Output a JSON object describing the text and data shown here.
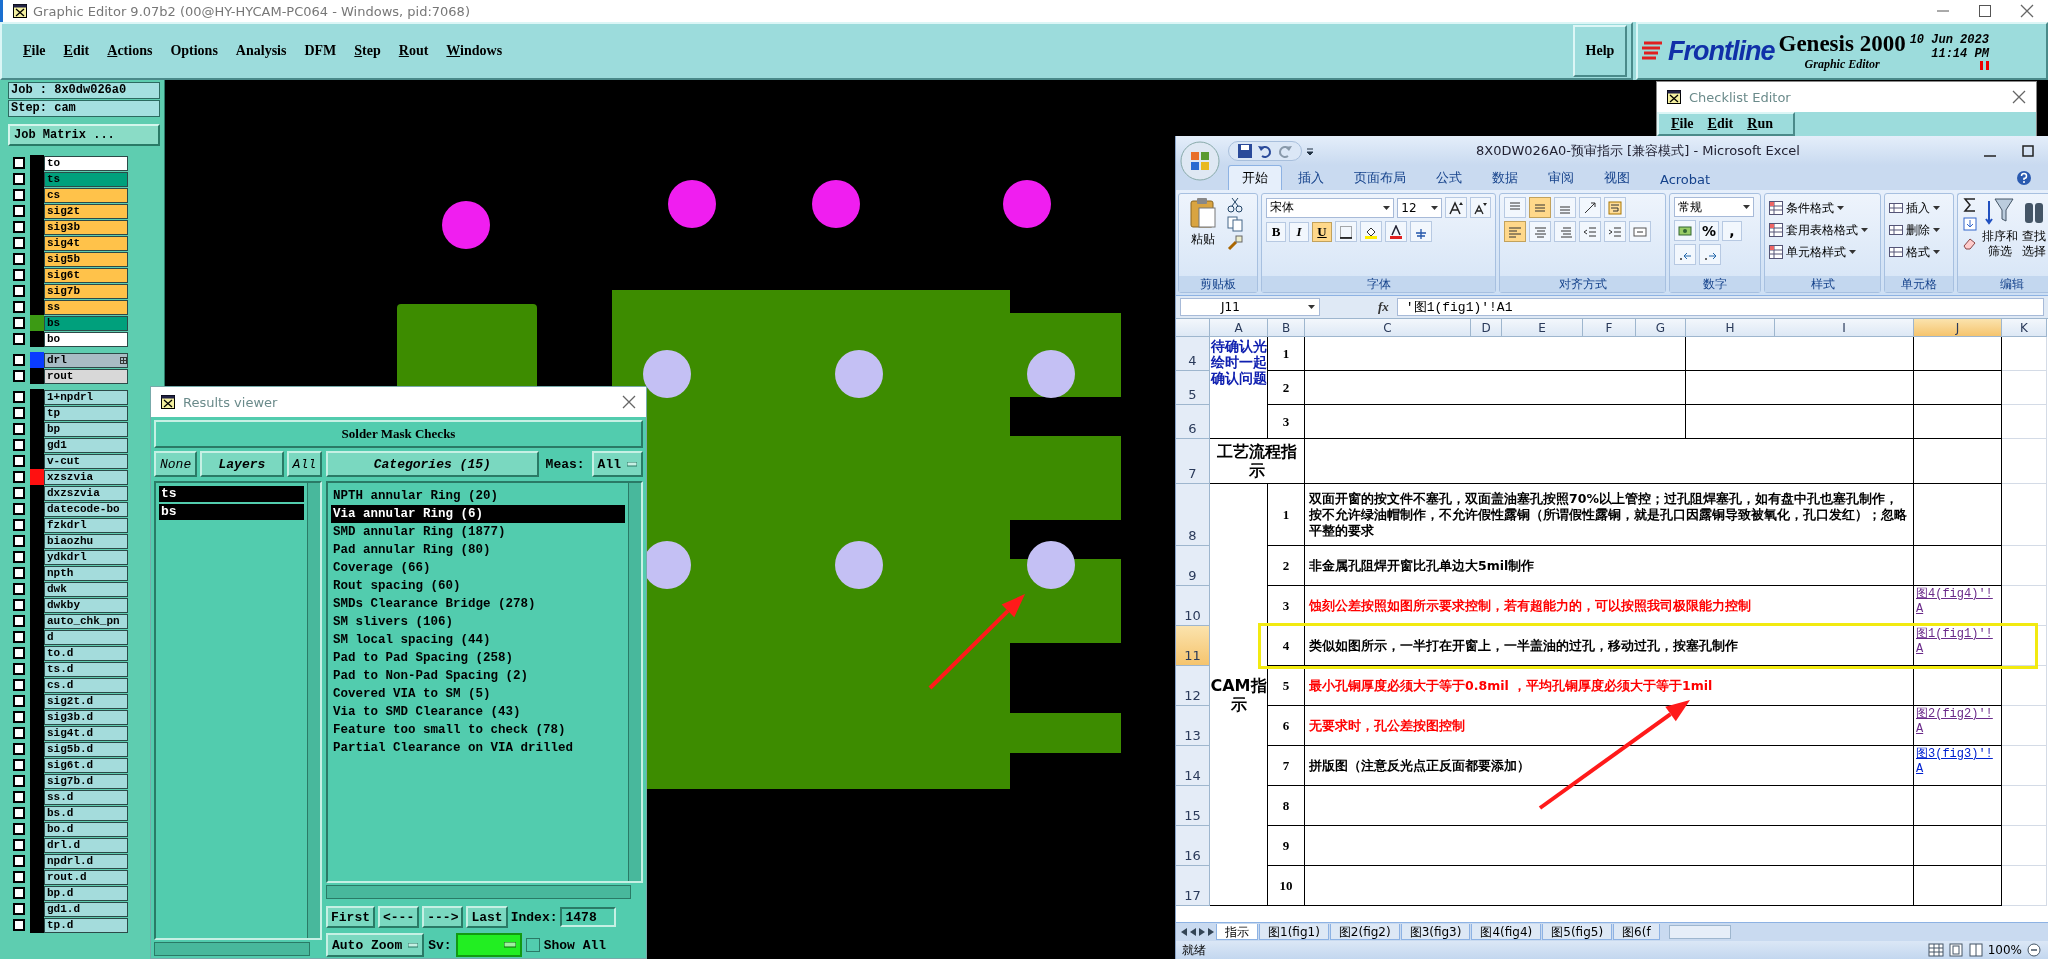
{
  "genesis": {
    "title": "Graphic Editor 9.07b2 (00@HY-HYCAM-PC064 - Windows, pid:7068)",
    "menu": [
      {
        "label": "File",
        "mnemonic": true
      },
      {
        "label": "Edit",
        "mnemonic": true
      },
      {
        "label": "Actions",
        "mnemonic": true
      },
      {
        "label": "Options",
        "mnemonic": false
      },
      {
        "label": "Analysis",
        "mnemonic": false
      },
      {
        "label": "DFM",
        "mnemonic": false
      },
      {
        "label": "Step",
        "mnemonic": true
      },
      {
        "label": "Rout",
        "mnemonic": true
      },
      {
        "label": "Windows",
        "mnemonic": true
      }
    ],
    "help": "Help",
    "logo": {
      "brand": "Frontline",
      "product": "Genesis 2000",
      "subtitle": "Graphic Editor",
      "date": "10 Jun 2023",
      "time": "11:14 PM"
    },
    "job": "Job : 8x0dw026a0",
    "step": "Step: cam",
    "job_matrix": "Job Matrix ...",
    "layer_groups": [
      [
        {
          "name": "to",
          "color": "#ffffff",
          "checked": false
        },
        {
          "name": "ts",
          "color": "#00a07c",
          "checked": false
        },
        {
          "name": "cs",
          "color": "#ffc24a",
          "checked": false
        },
        {
          "name": "sig2t",
          "color": "#ffc24a",
          "checked": false
        },
        {
          "name": "sig3b",
          "color": "#ffc24a",
          "checked": false
        },
        {
          "name": "sig4t",
          "color": "#ffc24a",
          "checked": false
        },
        {
          "name": "sig5b",
          "color": "#ffc24a",
          "checked": false
        },
        {
          "name": "sig6t",
          "color": "#ffc24a",
          "checked": false
        },
        {
          "name": "sig7b",
          "color": "#ffc24a",
          "checked": false
        },
        {
          "name": "ss",
          "color": "#ffc24a",
          "checked": false
        },
        {
          "name": "bs",
          "color": "#00a07c",
          "checked": false,
          "swatch": {
            "color": "#3c9a14"
          }
        },
        {
          "name": "bo",
          "color": "#ffffff",
          "checked": false
        }
      ],
      [
        {
          "name": "drl",
          "color": "#a8bcc4",
          "checked": false,
          "swatch": {
            "color": "#0a3cff"
          },
          "flag": true
        },
        {
          "name": "rout",
          "color": "#d8d8d8",
          "checked": false
        }
      ],
      [
        {
          "name": "1+npdrl",
          "color": "#a4dcdc",
          "checked": false
        },
        {
          "name": "tp",
          "color": "#a4dcdc",
          "checked": false
        },
        {
          "name": "bp",
          "color": "#a4dcdc",
          "checked": false
        },
        {
          "name": "gd1",
          "color": "#a4dcdc",
          "checked": false
        },
        {
          "name": "v-cut",
          "color": "#a4dcdc",
          "checked": false
        },
        {
          "name": "xzszvia",
          "color": "#a4dcdc",
          "checked": false,
          "swatch": {
            "color": "#ff1010"
          }
        },
        {
          "name": "dxzszvia",
          "color": "#a4dcdc",
          "checked": false
        },
        {
          "name": "datecode-bo",
          "color": "#a4dcdc",
          "checked": false
        },
        {
          "name": "fzkdrl",
          "color": "#a4dcdc",
          "checked": false
        },
        {
          "name": "biaozhu",
          "color": "#a4dcdc",
          "checked": false
        },
        {
          "name": "ydkdrl",
          "color": "#a4dcdc",
          "checked": false
        },
        {
          "name": "npth",
          "color": "#a4dcdc",
          "checked": false
        },
        {
          "name": "dwk",
          "color": "#a4dcdc",
          "checked": false
        },
        {
          "name": "dwkby",
          "color": "#a4dcdc",
          "checked": false
        },
        {
          "name": "auto_chk_pn",
          "color": "#a4dcdc",
          "checked": false
        },
        {
          "name": "d",
          "color": "#a4dcdc",
          "checked": false
        },
        {
          "name": "to.d",
          "color": "#a4dcdc",
          "checked": false
        },
        {
          "name": "ts.d",
          "color": "#a4dcdc",
          "checked": false
        },
        {
          "name": "cs.d",
          "color": "#a4dcdc",
          "checked": false
        },
        {
          "name": "sig2t.d",
          "color": "#a4dcdc",
          "checked": false
        },
        {
          "name": "sig3b.d",
          "color": "#a4dcdc",
          "checked": false
        },
        {
          "name": "sig4t.d",
          "color": "#a4dcdc",
          "checked": false
        },
        {
          "name": "sig5b.d",
          "color": "#a4dcdc",
          "checked": false
        },
        {
          "name": "sig6t.d",
          "color": "#a4dcdc",
          "checked": false
        },
        {
          "name": "sig7b.d",
          "color": "#a4dcdc",
          "checked": false
        },
        {
          "name": "ss.d",
          "color": "#a4dcdc",
          "checked": false
        },
        {
          "name": "bs.d",
          "color": "#a4dcdc",
          "checked": false
        },
        {
          "name": "bo.d",
          "color": "#a4dcdc",
          "checked": false
        },
        {
          "name": "drl.d",
          "color": "#a4dcdc",
          "checked": false
        },
        {
          "name": "npdrl.d",
          "color": "#a4dcdc",
          "checked": false
        },
        {
          "name": "rout.d",
          "color": "#a4dcdc",
          "checked": false
        },
        {
          "name": "bp.d",
          "color": "#a4dcdc",
          "checked": false
        },
        {
          "name": "gd1.d",
          "color": "#a4dcdc",
          "checked": false
        },
        {
          "name": "tp.d",
          "color": "#a4dcdc",
          "checked": false
        }
      ]
    ]
  },
  "results_viewer": {
    "title": "Results viewer",
    "header": "Solder Mask Checks",
    "layer_buttons": [
      {
        "label": "None",
        "kind": "action"
      },
      {
        "label": "Layers",
        "kind": "title"
      },
      {
        "label": "All",
        "kind": "action"
      }
    ],
    "layers": [
      {
        "name": "ts",
        "selected": true
      },
      {
        "name": "bs",
        "selected": true
      }
    ],
    "categories_button": "Categories (15)",
    "meas_label": "Meas:",
    "meas_value": "All",
    "categories": [
      {
        "label": "NPTH annular Ring (20)",
        "selected": false
      },
      {
        "label": "Via annular Ring (6)",
        "selected": true
      },
      {
        "label": "SMD annular Ring (1877)",
        "selected": false
      },
      {
        "label": "Pad annular Ring (80)",
        "selected": false
      },
      {
        "label": "Coverage (66)",
        "selected": false
      },
      {
        "label": "Rout spacing (60)",
        "selected": false
      },
      {
        "label": "SMDs Clearance Bridge (278)",
        "selected": false
      },
      {
        "label": "SM slivers (106)",
        "selected": false
      },
      {
        "label": "SM local spacing (44)",
        "selected": false
      },
      {
        "label": "Pad to Pad Spacing (258)",
        "selected": false
      },
      {
        "label": "Pad to Non-Pad Spacing (2)",
        "selected": false
      },
      {
        "label": "Covered VIA to SM (5)",
        "selected": false
      },
      {
        "label": "Via to SMD Clearance (43)",
        "selected": false
      },
      {
        "label": "Feature too small to check (78)",
        "selected": false
      },
      {
        "label": "Partial Clearance on VIA drilled",
        "selected": false
      }
    ],
    "nav_buttons": [
      "First",
      "<---",
      "--->",
      "Last"
    ],
    "index_label": "Index:",
    "index_value": "1478",
    "zoom_mode": "Auto Zoom",
    "sv_label": "Sv:",
    "show_all": {
      "label": "Show All",
      "checked": false
    }
  },
  "checklist_editor": {
    "title": "Checklist Editor",
    "menu": [
      {
        "label": "File",
        "mnemonic": true
      },
      {
        "label": "Edit",
        "mnemonic": true
      },
      {
        "label": "Run",
        "mnemonic": true
      }
    ]
  },
  "excel": {
    "title": "8X0DW026A0-预审指示 [兼容模式] - Microsoft Excel",
    "tabs": [
      {
        "label": "开始",
        "selected": true
      },
      {
        "label": "插入",
        "selected": false
      },
      {
        "label": "页面布局",
        "selected": false
      },
      {
        "label": "公式",
        "selected": false
      },
      {
        "label": "数据",
        "selected": false
      },
      {
        "label": "审阅",
        "selected": false
      },
      {
        "label": "视图",
        "selected": false
      },
      {
        "label": "Acrobat",
        "selected": false
      }
    ],
    "ribbon": {
      "paste": "粘贴",
      "clipboard_group": "剪贴板",
      "font_name": "宋体",
      "font_size": "12",
      "format_buttons": [
        {
          "label": "B",
          "selected": false
        },
        {
          "label": "I",
          "selected": false
        },
        {
          "label": "U",
          "selected": true
        }
      ],
      "font_group": "字体",
      "valign": [
        {
          "selected": false
        },
        {
          "selected": true
        },
        {
          "selected": false
        }
      ],
      "halign": [
        {
          "selected": true
        },
        {
          "selected": false
        },
        {
          "selected": false
        }
      ],
      "align_group": "对齐方式",
      "number_format": "常规",
      "percent": "%",
      "comma": ",",
      "number_group": "数字",
      "styles": [
        "条件格式",
        "套用表格格式",
        "单元格样式"
      ],
      "styles_group": "样式",
      "cells": [
        "插入",
        "删除",
        "格式"
      ],
      "cells_group": "单元格",
      "sort": "排序和筛选",
      "find": "查找",
      "select": "选择",
      "edit_group": "编辑"
    },
    "name_box": "J11",
    "fx": "fx",
    "formula": "'图1(fig1)'!A1",
    "sheet": {
      "columns": [
        {
          "label": "A",
          "selected": false
        },
        {
          "label": "B",
          "selected": false
        },
        {
          "label": "C",
          "selected": false
        },
        {
          "label": "D",
          "selected": false
        },
        {
          "label": "E",
          "selected": false
        },
        {
          "label": "F",
          "selected": false
        },
        {
          "label": "G",
          "selected": false
        },
        {
          "label": "H",
          "selected": false
        },
        {
          "label": "I",
          "selected": false
        },
        {
          "label": "J",
          "selected": true
        },
        {
          "label": "K",
          "selected": false
        }
      ],
      "rows": [
        {
          "label": "4",
          "selected": false
        },
        {
          "label": "5",
          "selected": false
        },
        {
          "label": "6",
          "selected": false
        },
        {
          "label": "7",
          "selected": false
        },
        {
          "label": "8",
          "selected": false
        },
        {
          "label": "9",
          "selected": false
        },
        {
          "label": "10",
          "selected": false
        },
        {
          "label": "11",
          "selected": true
        },
        {
          "label": "12",
          "selected": false
        },
        {
          "label": "13",
          "selected": false
        },
        {
          "label": "14",
          "selected": false
        },
        {
          "label": "15",
          "selected": false
        },
        {
          "label": "16",
          "selected": false
        },
        {
          "label": "17",
          "selected": false
        }
      ],
      "pending": {
        "label": "待确认光绘时一起确认问题",
        "items": [
          "1",
          "2",
          "3"
        ]
      },
      "process": {
        "label": "工艺流程指示"
      },
      "cam": {
        "label": "CAM指示",
        "items": [
          {
            "no": "1",
            "text": "双面开窗的按文件不塞孔，双面盖油塞孔按照70%以上管控；过孔阻焊塞孔，如有盘中孔也塞孔制作，按不允许绿油帽制作，不允许假性露铜（所谓假性露铜，就是孔口因露铜导致被氧化，孔口发红）；忽略平整的要求",
            "kind": "normal",
            "highlighted": false
          },
          {
            "no": "2",
            "text": "非金属孔阻焊开窗比孔单边大5mil制作",
            "kind": "normal",
            "highlighted": false
          },
          {
            "no": "3",
            "text": "蚀刻公差按照如图所示要求控制，若有超能力的，可以按照我司极限能力控制",
            "kind": "warning",
            "highlighted": false,
            "link": "图4(fig4)'!A",
            "visited": true
          },
          {
            "no": "4",
            "text": "类似如图所示，一半打在开窗上，一半盖油的过孔，移动过孔，按塞孔制作",
            "kind": "normal",
            "highlighted": true,
            "link": "图1(fig1)'!A",
            "visited": true
          },
          {
            "no": "5",
            "text": "最小孔铜厚度必须大于等于0.8mil ，平均孔铜厚度必须大于等于1mil",
            "kind": "warning",
            "highlighted": false
          },
          {
            "no": "6",
            "text": "无要求时，孔公差按图控制",
            "kind": "warning",
            "highlighted": false,
            "link": "图2(fig2)'!A",
            "visited": true
          },
          {
            "no": "7",
            "text": "拼版图（注意反光点正反面都要添加）",
            "kind": "normal",
            "highlighted": false,
            "link": "图3(fig3)'!A",
            "visited": false
          },
          {
            "no": "8",
            "highlighted": false
          },
          {
            "no": "9",
            "highlighted": false
          },
          {
            "no": "10",
            "highlighted": false
          }
        ]
      }
    },
    "sheet_tabs": [
      {
        "label": "指示",
        "selected": true
      },
      {
        "label": "图1(fig1)",
        "selected": false
      },
      {
        "label": "图2(fig2)",
        "selected": false
      },
      {
        "label": "图3(fig3)",
        "selected": false
      },
      {
        "label": "图4(fig4)",
        "selected": false
      },
      {
        "label": "图5(fig5)",
        "selected": false
      },
      {
        "label": "图6(f",
        "selected": false
      }
    ],
    "status": "就绪",
    "zoom": "100%"
  }
}
